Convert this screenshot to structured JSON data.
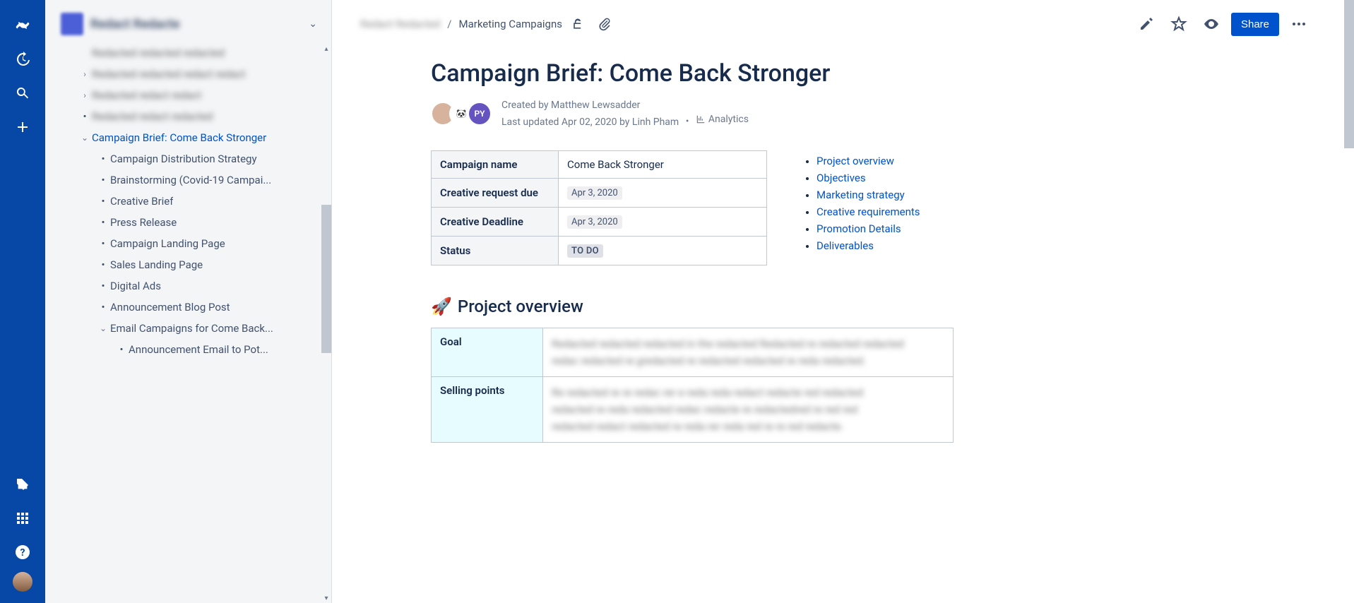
{
  "space": {
    "name": "Redact Redacte"
  },
  "sidebar": {
    "blurred_top": [
      "Redacted redacted redacted"
    ],
    "blurred_collapsed": [
      "Redacted redacted redact redact",
      "Redacted redact redact"
    ],
    "blurred_leaf": "Redacted redact redacted",
    "active": "Campaign Brief: Come Back Stronger",
    "children": [
      "Campaign Distribution Strategy",
      "Brainstorming (Covid-19 Campai...",
      "Creative Brief",
      "Press Release",
      "Campaign Landing Page",
      "Sales Landing Page",
      "Digital Ads",
      "Announcement Blog Post"
    ],
    "expand_child": "Email Campaigns for Come Back...",
    "grandchild": "Announcement Email to Pot..."
  },
  "breadcrumb": {
    "first": "Redact Redacted",
    "second": "Marketing Campaigns"
  },
  "actions": {
    "share": "Share"
  },
  "page": {
    "title": "Campaign Brief: Come Back Stronger",
    "created_by": "Created by Matthew Lewsadder",
    "updated": "Last updated Apr 02, 2020 by Linh Pham",
    "analytics": "Analytics",
    "avatars": [
      {
        "bg": "#d7b29d",
        "text": ""
      },
      {
        "bg": "#ffffff",
        "text": "🐼"
      },
      {
        "bg": "#6554C0",
        "text": "PY",
        "color": "#fff"
      }
    ]
  },
  "info_table": [
    {
      "k": "Campaign name",
      "v": "Come Back Stronger",
      "chip": false
    },
    {
      "k": "Creative request due",
      "v": "Apr 3, 2020",
      "chip": true
    },
    {
      "k": "Creative Deadline",
      "v": "Apr 3, 2020",
      "chip": true
    },
    {
      "k": "Status",
      "v": "TO DO",
      "chip": "todo"
    }
  ],
  "toc": [
    "Project overview",
    "Objectives",
    "Marketing strategy",
    "Creative requirements",
    "Promotion Details",
    "Deliverables"
  ],
  "section_overview": {
    "heading": "Project overview",
    "rows": [
      {
        "k": "Goal",
        "v": [
          "Redacted redacted redacted in the redacted Redacted re redacted redacted",
          "redac redacted re gredacted re redacted redacted re reda redacted."
        ]
      },
      {
        "k": "Selling points",
        "v": [
          "Re redacted re re redac rer e reda reda redact redacte red redacted",
          "redacted re reda redacted redac redacte re redactedred re red red",
          "redacted redact redacted re reda rer reda red re re red redacte."
        ]
      }
    ]
  }
}
